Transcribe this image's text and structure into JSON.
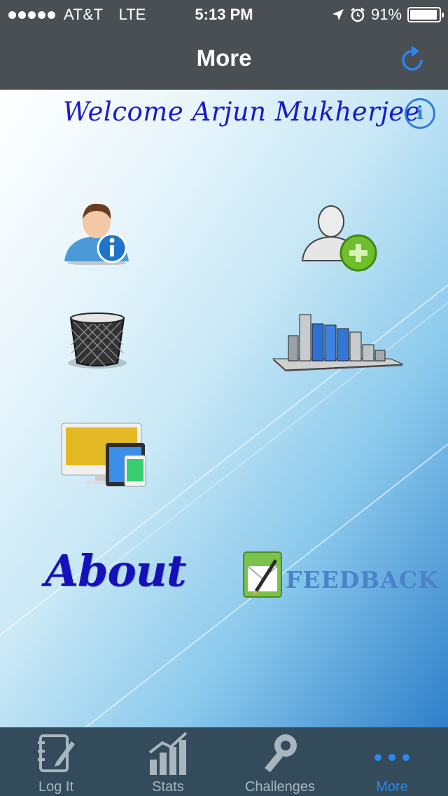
{
  "status_bar": {
    "carrier": "AT&T",
    "network": "LTE",
    "time": "5:13 PM",
    "battery": "91%"
  },
  "nav": {
    "title": "More",
    "refresh_icon": "refresh-icon"
  },
  "main": {
    "welcome": "Welcome Arjun Mukherjee",
    "info_icon": "info-icon",
    "info_glyph": "i",
    "tiles": [
      {
        "name": "profile-info",
        "icon": "user-info-icon"
      },
      {
        "name": "add-user",
        "icon": "add-user-icon"
      },
      {
        "name": "delete",
        "icon": "trash-icon"
      },
      {
        "name": "charts",
        "icon": "bar-chart-icon"
      },
      {
        "name": "devices",
        "icon": "devices-icon"
      }
    ],
    "about_label": "About",
    "feedback_label": "Feedback"
  },
  "tabbar": {
    "tabs": [
      {
        "label": "Log It",
        "icon": "notebook-icon",
        "active": false
      },
      {
        "label": "Stats",
        "icon": "stats-icon",
        "active": false
      },
      {
        "label": "Challenges",
        "icon": "bottle-opener-icon",
        "active": false
      },
      {
        "label": "More",
        "icon": "more-icon",
        "active": true
      }
    ],
    "active_color": "#2a88e6",
    "inactive_color": "#a9b6bf"
  },
  "colors": {
    "nav_background": "#4a4f54",
    "tabbar_background": "#344b5c",
    "welcome_text": "#1a1ac8",
    "accent": "#2b7fd8"
  }
}
